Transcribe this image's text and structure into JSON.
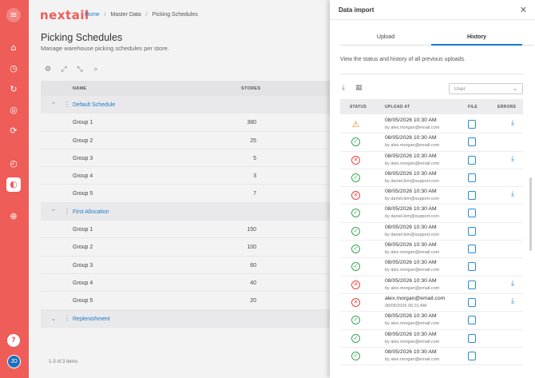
{
  "brand": "nextail",
  "breadcrumb": [
    "Home",
    "Master Data",
    "Picking Schedules"
  ],
  "page": {
    "title": "Picking Schedules",
    "subtitle": "Manage warehouse picking schedules per store."
  },
  "table": {
    "col_name": "NAME",
    "col_stores": "STORES",
    "rows": [
      {
        "name": "Default Schedule",
        "group": true
      },
      {
        "name": "Group 1",
        "stores": "380"
      },
      {
        "name": "Group 2",
        "stores": "25"
      },
      {
        "name": "Group 3",
        "stores": "5"
      },
      {
        "name": "Group 4",
        "stores": "3"
      },
      {
        "name": "Group 5",
        "stores": "7"
      },
      {
        "name": "First Allocation",
        "group": true
      },
      {
        "name": "Group 1",
        "stores": "150"
      },
      {
        "name": "Group 2",
        "stores": "100"
      },
      {
        "name": "Group 3",
        "stores": "60"
      },
      {
        "name": "Group 4",
        "stores": "40"
      },
      {
        "name": "Group 5",
        "stores": "20"
      },
      {
        "name": "Replenishment",
        "group": true,
        "collapsed": true
      }
    ],
    "count": "1-3 of 3 items"
  },
  "avatar": "JD",
  "panel": {
    "title": "Data import",
    "tabs": [
      "Upload",
      "History"
    ],
    "active_tab": "History",
    "description": "View the status and history of all previous uploads.",
    "user_placeholder": "User",
    "headers": {
      "status": "STATUS",
      "upload_at": "UPLOAD AT",
      "file": "FILE",
      "errors": "ERRORS"
    },
    "uploads": [
      {
        "status": "warning",
        "at": "08/05/2026 10:30 AM",
        "by": "by alex.morgan@email.com",
        "has_errors": true
      },
      {
        "status": "success",
        "at": "08/05/2026 10:30 AM",
        "by": "by alex.morgan@email.com",
        "has_errors": false
      },
      {
        "status": "error",
        "at": "08/05/2026 10:30 AM",
        "by": "by alex.morgan@email.com",
        "has_errors": true
      },
      {
        "status": "success",
        "at": "08/05/2026 10:30 AM",
        "by": "by daniel.kim@support.com",
        "has_errors": false
      },
      {
        "status": "error",
        "at": "08/05/2026 10:30 AM",
        "by": "by daniel.kim@support.com",
        "has_errors": true
      },
      {
        "status": "success",
        "at": "08/05/2026 10:30 AM",
        "by": "by daniel.kim@support.com",
        "has_errors": false
      },
      {
        "status": "success",
        "at": "08/05/2026 10:30 AM",
        "by": "by daniel.kim@support.com",
        "has_errors": false
      },
      {
        "status": "success",
        "at": "08/05/2026 10:30 AM",
        "by": "by alex.morgan@email.com",
        "has_errors": false
      },
      {
        "status": "success",
        "at": "08/05/2026 10:30 AM",
        "by": "by alex.morgan@email.com",
        "has_errors": false
      },
      {
        "status": "error",
        "at": "08/05/2026 10:30 AM",
        "by": "by alex.morgan@email.com",
        "has_errors": true
      },
      {
        "status": "error",
        "at": "alex.morgan@email.com",
        "by": "08/05/2026 06:31 AM",
        "has_errors": true
      },
      {
        "status": "success",
        "at": "08/05/2026 10:30 AM",
        "by": "by alex.morgan@email.com",
        "has_errors": false
      },
      {
        "status": "success",
        "at": "08/05/2026 10:30 AM",
        "by": "by alex.morgan@email.com",
        "has_errors": false
      },
      {
        "status": "success",
        "at": "08/05/2026 10:30 AM",
        "by": "by alex.morgan@email.com",
        "has_errors": false
      }
    ]
  }
}
